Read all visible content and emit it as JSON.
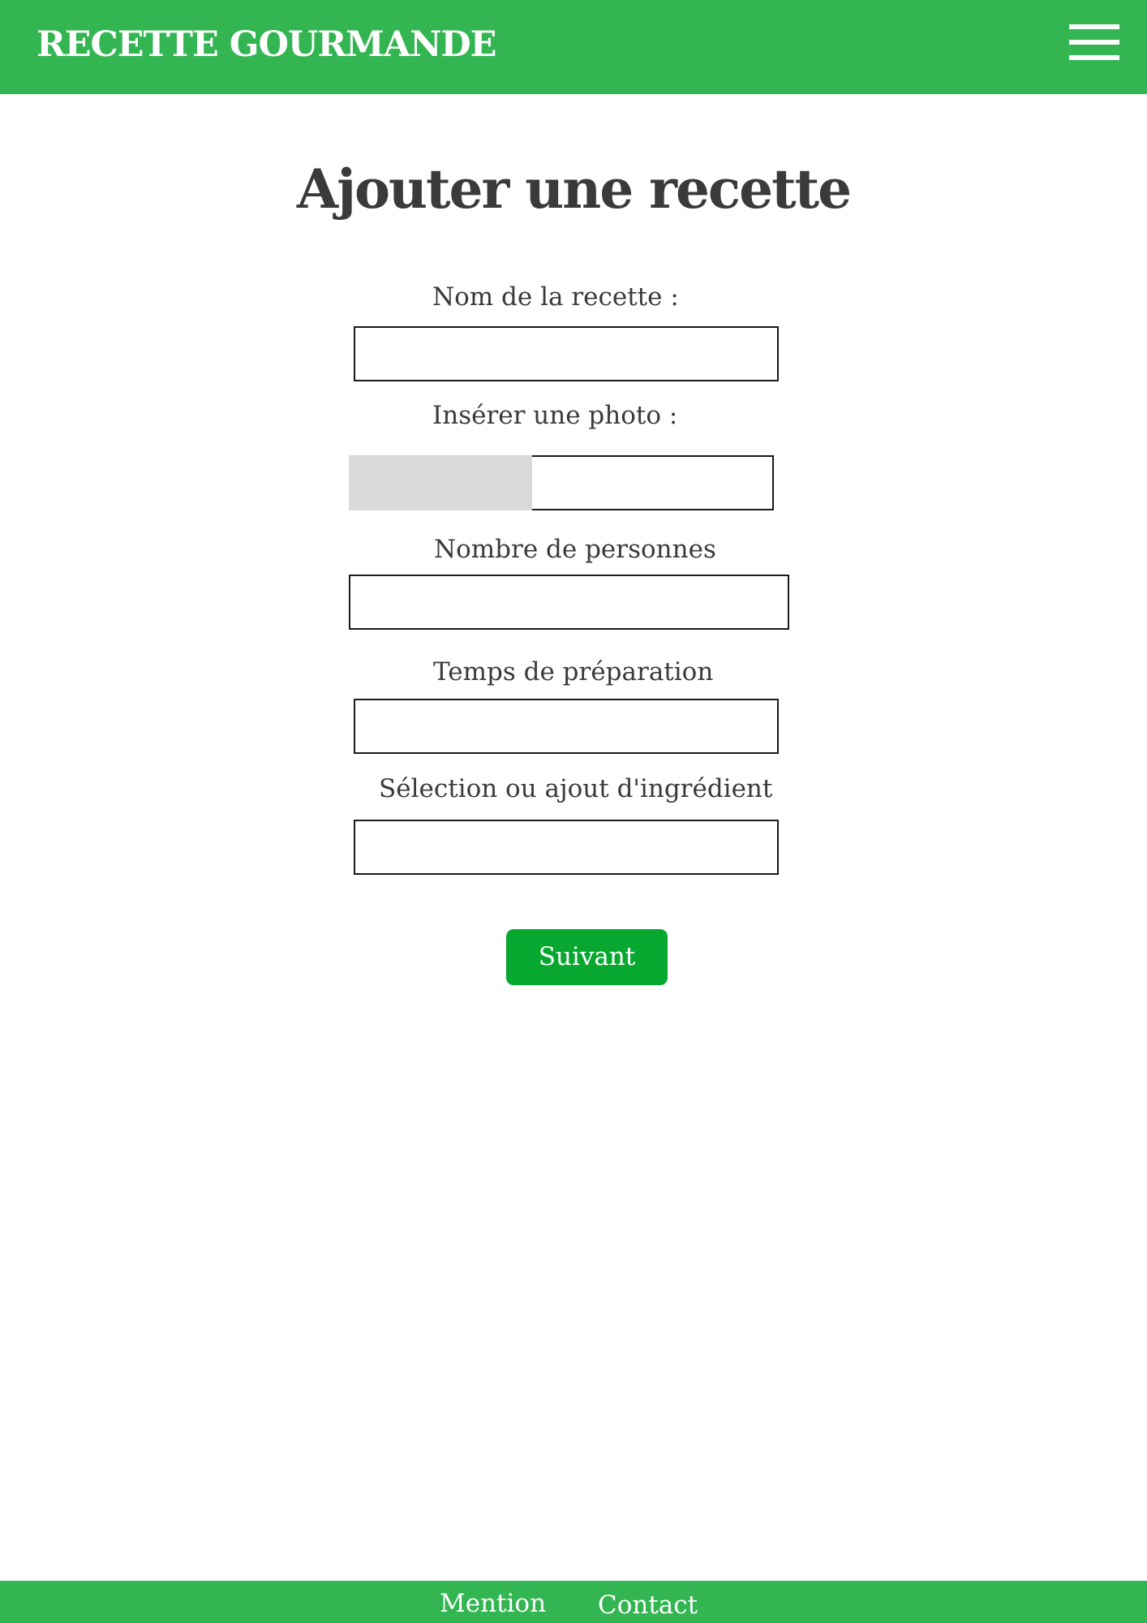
{
  "header": {
    "brand": "RECETTE GOURMANDE",
    "menu_icon": "hamburger-menu-icon",
    "background_color": "#33b552"
  },
  "main": {
    "title": "Ajouter une recette",
    "form": {
      "recipe_name": {
        "label": "Nom de la recette :",
        "value": "",
        "placeholder": ""
      },
      "photo": {
        "label": "Insérer une photo :",
        "value": ""
      },
      "servings": {
        "label": "Nombre de personnes",
        "value": "",
        "placeholder": ""
      },
      "prep_time": {
        "label": "Temps de préparation",
        "value": "",
        "placeholder": ""
      },
      "ingredient": {
        "label": "Sélection ou ajout d'ingrédient",
        "value": "",
        "placeholder": ""
      }
    },
    "submit_label": "Suivant",
    "submit_color": "#08a830"
  },
  "footer": {
    "links": [
      "Mention",
      "Contact"
    ],
    "background_color": "#33b552"
  }
}
